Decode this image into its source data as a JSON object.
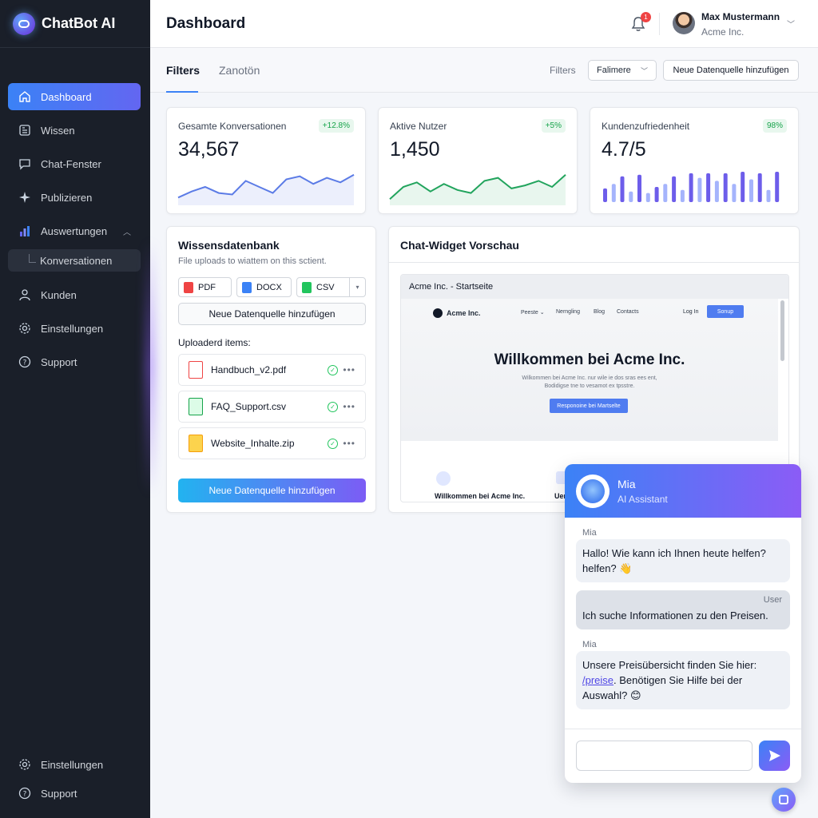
{
  "app": {
    "name": "ChatBot AI"
  },
  "sidebar": {
    "items": [
      {
        "label": "Dashboard",
        "icon": "home-icon"
      },
      {
        "label": "Wissen",
        "icon": "book-icon"
      },
      {
        "label": "Chat-Fenster",
        "icon": "chat-icon"
      },
      {
        "label": "Publizieren",
        "icon": "sparkle-icon"
      },
      {
        "label": "Auswertungen",
        "icon": "bar-chart-icon"
      },
      {
        "label": "Konversationen",
        "icon": ""
      },
      {
        "label": "Kunden",
        "icon": "user-icon"
      },
      {
        "label": "Einstellungen",
        "icon": "gear-icon"
      },
      {
        "label": "Support",
        "icon": "help-icon"
      }
    ],
    "bottom": [
      {
        "label": "Einstellungen",
        "icon": "gear-icon"
      },
      {
        "label": "Support",
        "icon": "help-icon"
      }
    ]
  },
  "header": {
    "title": "Dashboard",
    "notification_count": "1",
    "user_name": "Max Mustermann",
    "user_org": "Acme Inc."
  },
  "filters": {
    "tabs": [
      "Filters",
      "Zanotön"
    ],
    "label": "Filters",
    "select_value": "Falimere",
    "add_button": "Neue Datenquelle hinzufügen"
  },
  "stats": [
    {
      "label": "Gesamte Konversationen",
      "value": "34,567",
      "badge": "+12.8%",
      "spark": [
        0.15,
        0.35,
        0.5,
        0.3,
        0.25,
        0.7,
        0.5,
        0.3,
        0.75,
        0.85,
        0.6,
        0.8,
        0.65,
        0.9
      ]
    },
    {
      "label": "Aktive Nutzer",
      "value": "1,450",
      "badge": "+5%",
      "spark": [
        0.1,
        0.5,
        0.65,
        0.35,
        0.6,
        0.4,
        0.3,
        0.7,
        0.8,
        0.45,
        0.55,
        0.7,
        0.5,
        0.9
      ]
    },
    {
      "label": "Kundenzufriedenheit",
      "value": "4.7/5",
      "badge": "98%",
      "bars": [
        0.45,
        0.6,
        0.85,
        0.35,
        0.9,
        0.3,
        0.5,
        0.6,
        0.85,
        0.4,
        0.95,
        0.8,
        0.95,
        0.7,
        0.95,
        0.6,
        1.0,
        0.75,
        0.95,
        0.4,
        1.0
      ]
    }
  ],
  "knowledge": {
    "title": "Wissensdatenbank",
    "subtitle": "File uploads to wiattem on this sctient.",
    "types": [
      "PDF",
      "DOCX",
      "CSV"
    ],
    "add_label": "Neue Datenquelle hinzufügen",
    "uploaded_label": "Uploaderd items:",
    "files": [
      "Handbuch_v2.pdf",
      "FAQ_Support.csv",
      "Website_Inhalte.zip"
    ],
    "primary_button": "Neue Datenquelle hinzufügen"
  },
  "preview": {
    "title": "Chat-Widget Vorschau",
    "browser_title": "Acme Inc. - Startseite",
    "site_brand": "Acme Inc.",
    "site_nav": [
      "Peeste ⌄",
      "Nerngling",
      "Blog",
      "Contacts"
    ],
    "site_login": "Log In",
    "site_signup": "Sonup",
    "site_heading": "Willkommen bei Acme Inc.",
    "site_line1": "Wilkommen bei Acme Inc. nur wile ie dos sras ees ent,",
    "site_line2": "Bodidigse tne to vesamot ex tpsstre.",
    "site_cta": "Responoine bei Martselte",
    "feature1": "Willkommen bei Acme Inc.",
    "feature2": "Uer"
  },
  "chat": {
    "bot_name": "Mia",
    "bot_role": "AI Assistant",
    "messages": [
      {
        "who": "Mia",
        "text": "Hallo! Wie kann ich Ihnen heute helfen? helfen? 👋"
      },
      {
        "who": "User",
        "text": "Ich suche Informationen zu den Preisen."
      },
      {
        "who": "Mia",
        "text_before": "Unsere Preisübersicht finden Sie hier: ",
        "link": "/preise",
        "text_after": ". Benötigen Sie Hilfe bei der Auswahl? 😊"
      }
    ]
  },
  "colors": {
    "accent": "#3b82f6",
    "accent2": "#8b5cf6",
    "sidebar": "#1a1f29",
    "success": "#16a34a"
  }
}
